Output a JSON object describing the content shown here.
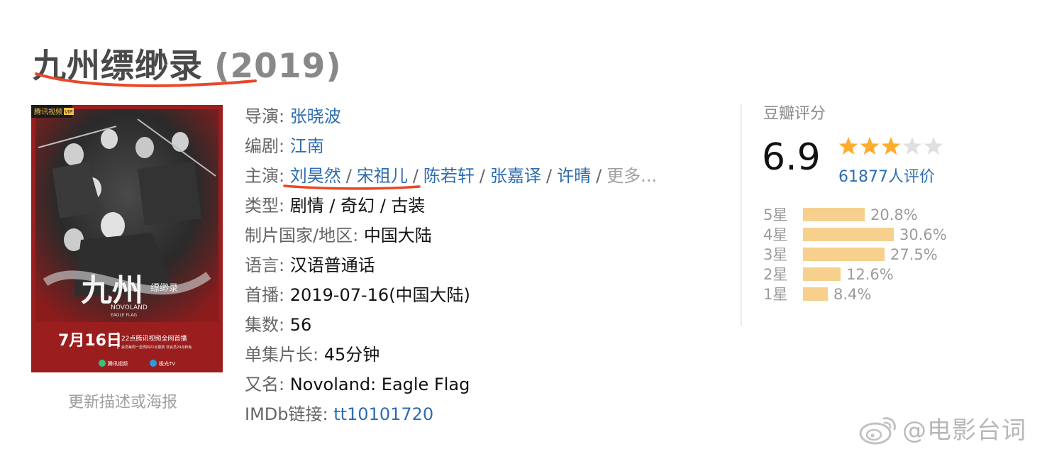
{
  "header": {
    "title": "九州缥缈录",
    "year": "(2019)"
  },
  "poster": {
    "update_label": "更新描述或海报",
    "tag": "腾讯视频",
    "vip": "VIP",
    "title_cn": "九州",
    "title_small": "缥缈录",
    "title_en": "NOVOLAND",
    "subtitle_en": "EAGLE FLAG",
    "release_date": "7月16日",
    "release_text": "22点腾讯视频全网首播",
    "release_sub": "会员每周一至周四22点更新 非会员24点转免",
    "logo1": "腾讯视频",
    "logo2": "极光TV"
  },
  "info": {
    "director_label": "导演",
    "director": "张晓波",
    "writer_label": "编剧",
    "writer": "江南",
    "cast_label": "主演",
    "cast": [
      "刘昊然",
      "宋祖儿",
      "陈若轩",
      "张嘉译",
      "许晴"
    ],
    "cast_more": "更多...",
    "genre_label": "类型",
    "genre": "剧情 / 奇幻 / 古装",
    "country_label": "制片国家/地区",
    "country": "中国大陆",
    "language_label": "语言",
    "language": "汉语普通话",
    "premiere_label": "首播",
    "premiere": "2019-07-16(中国大陆)",
    "episodes_label": "集数",
    "episodes": "56",
    "runtime_label": "单集片长",
    "runtime": "45分钟",
    "aka_label": "又名",
    "aka": "Novoland: Eagle Flag",
    "imdb_label": "IMDb链接",
    "imdb": "tt10101720"
  },
  "rating": {
    "title": "豆瓣评分",
    "score": "6.9",
    "stars": 3.5,
    "votes": "61877人评价",
    "distribution": [
      {
        "label": "5星",
        "percent": "20.8%",
        "value": 20.8
      },
      {
        "label": "4星",
        "percent": "30.6%",
        "value": 30.6
      },
      {
        "label": "3星",
        "percent": "27.5%",
        "value": 27.5
      },
      {
        "label": "2星",
        "percent": "12.6%",
        "value": 12.6
      },
      {
        "label": "1星",
        "percent": "8.4%",
        "value": 8.4
      }
    ]
  },
  "watermark": {
    "text": "@电影台词"
  },
  "colors": {
    "link": "#2e6db0",
    "title": "#494949",
    "year": "#888888",
    "star": "#ffac2d",
    "star_empty": "#e0e0e0",
    "bar": "#f7d08d",
    "underline": "#e8472a",
    "poster_bg": "#9b1e1e"
  }
}
